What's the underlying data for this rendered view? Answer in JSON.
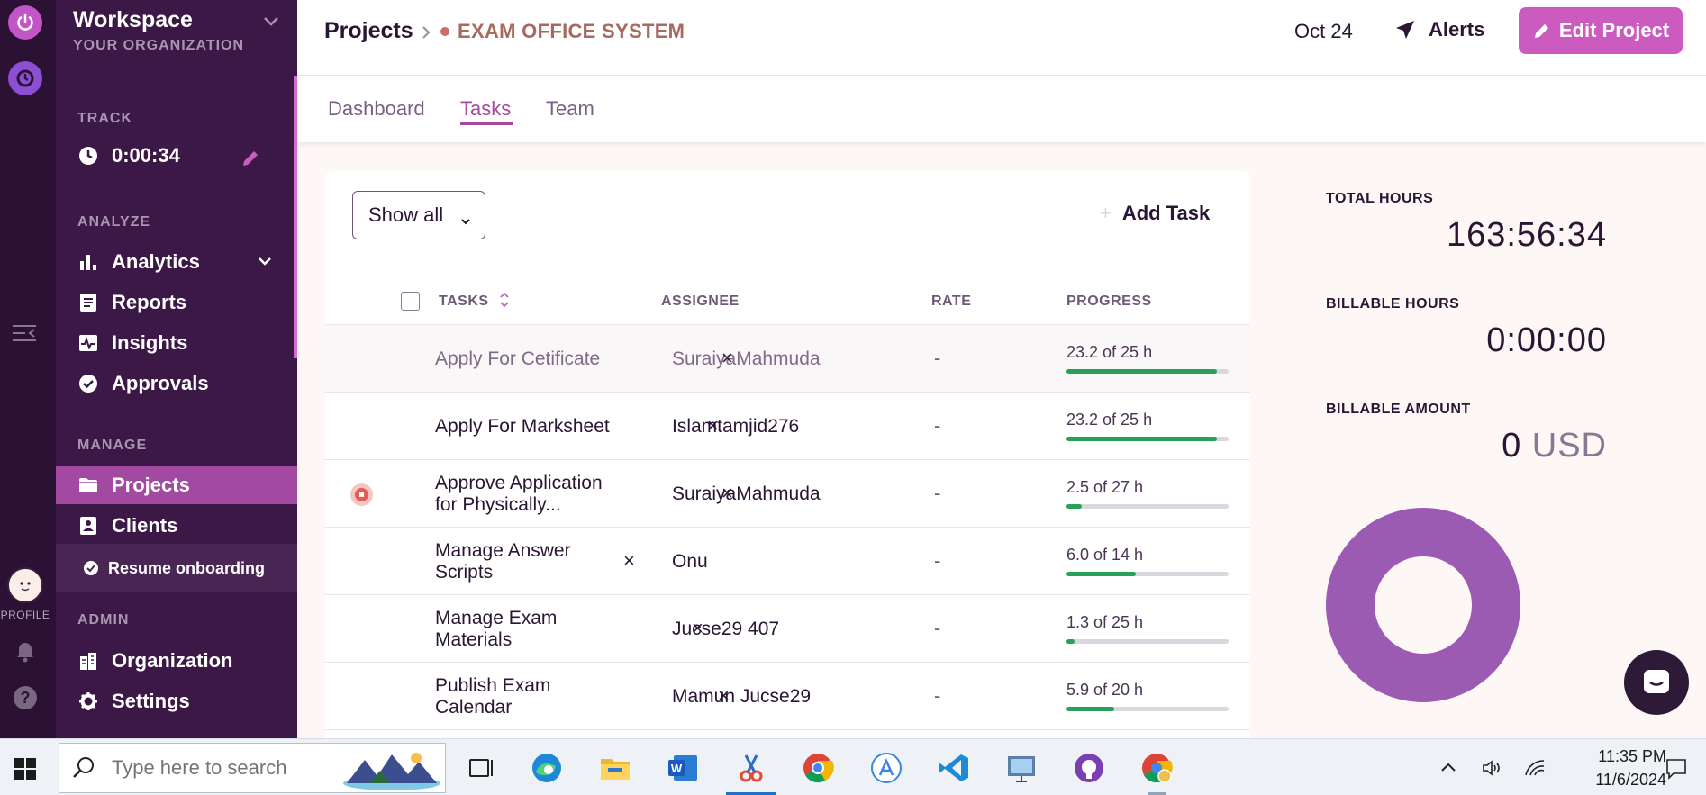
{
  "workspace": {
    "name": "Workspace",
    "org": "YOUR ORGANIZATION"
  },
  "rail": {
    "profile_label": "PROFILE",
    "help_glyph": "?"
  },
  "sidebar": {
    "track_label": "TRACK",
    "timer": "0:00:34",
    "analyze_label": "ANALYZE",
    "analyze_items": [
      {
        "label": "Analytics",
        "icon": "bar-chart-icon"
      },
      {
        "label": "Reports",
        "icon": "document-icon"
      },
      {
        "label": "Insights",
        "icon": "pulse-icon"
      },
      {
        "label": "Approvals",
        "icon": "check-circle-icon"
      }
    ],
    "manage_label": "MANAGE",
    "manage_items": [
      {
        "label": "Projects",
        "icon": "folder-icon",
        "active": true
      },
      {
        "label": "Clients",
        "icon": "contact-card-icon"
      }
    ],
    "onboarding": "Resume onboarding",
    "admin_label": "ADMIN",
    "admin_items": [
      {
        "label": "Organization",
        "icon": "building-icon"
      },
      {
        "label": "Settings",
        "icon": "gear-icon"
      }
    ]
  },
  "header": {
    "breadcrumb_root": "Projects",
    "project_name": "EXAM OFFICE SYSTEM",
    "date": "Oct 24",
    "alerts": "Alerts",
    "edit_button": "Edit Project"
  },
  "tabs": [
    {
      "label": "Dashboard",
      "active": false
    },
    {
      "label": "Tasks",
      "active": true
    },
    {
      "label": "Team",
      "active": false
    }
  ],
  "tasks_panel": {
    "filter": "Show all",
    "add_task": "Add Task",
    "columns": {
      "tasks": "TASKS",
      "assignee": "ASSIGNEE",
      "rate": "RATE",
      "progress": "PROGRESS"
    },
    "rows": [
      {
        "task": "Apply For Cetificate",
        "assignee": "SuraiyaMahmuda",
        "rate": "-",
        "progress": "23.2 of 25 h",
        "fraction": 0.928,
        "running": false
      },
      {
        "task": "Apply For Marksheet",
        "assignee": "Islamtamjid276",
        "rate": "-",
        "progress": "23.2 of 25 h",
        "fraction": 0.928,
        "running": false
      },
      {
        "task": "Approve Application for Physically...",
        "assignee": "SuraiyaMahmuda",
        "rate": "-",
        "progress": "2.5 of 27 h",
        "fraction": 0.093,
        "running": true
      },
      {
        "task": "Manage Answer Scripts",
        "assignee": "Onu",
        "rate": "-",
        "progress": "6.0 of 14 h",
        "fraction": 0.429,
        "running": false
      },
      {
        "task": "Manage Exam Materials",
        "assignee": "Jucse29 407",
        "rate": "-",
        "progress": "1.3 of 25 h",
        "fraction": 0.052,
        "running": false
      },
      {
        "task": "Publish Exam Calendar",
        "assignee": "Mamun Jucse29",
        "rate": "-",
        "progress": "5.9 of 20 h",
        "fraction": 0.295,
        "running": false
      }
    ],
    "remove_glyph": "×"
  },
  "stats": {
    "total_hours_label": "TOTAL HOURS",
    "total_hours": "163:56:34",
    "billable_hours_label": "BILLABLE HOURS",
    "billable_hours": "0:00:00",
    "billable_amount_label": "BILLABLE AMOUNT",
    "billable_amount": "0",
    "currency": "USD",
    "donut_color": "#9c5bb3"
  },
  "taskbar": {
    "search_placeholder": "Type here to search",
    "time": "11:35 PM",
    "date": "11/6/2024",
    "apps": [
      "task-view",
      "edge",
      "file-explorer",
      "word",
      "snipping-tool",
      "chrome",
      "app-store",
      "vscode",
      "presentation",
      "github",
      "chrome-profile"
    ]
  },
  "colors": {
    "accent": "#cc5bc0",
    "sidebar_bg": "#3b1845",
    "progress_fill": "#27a05a"
  }
}
